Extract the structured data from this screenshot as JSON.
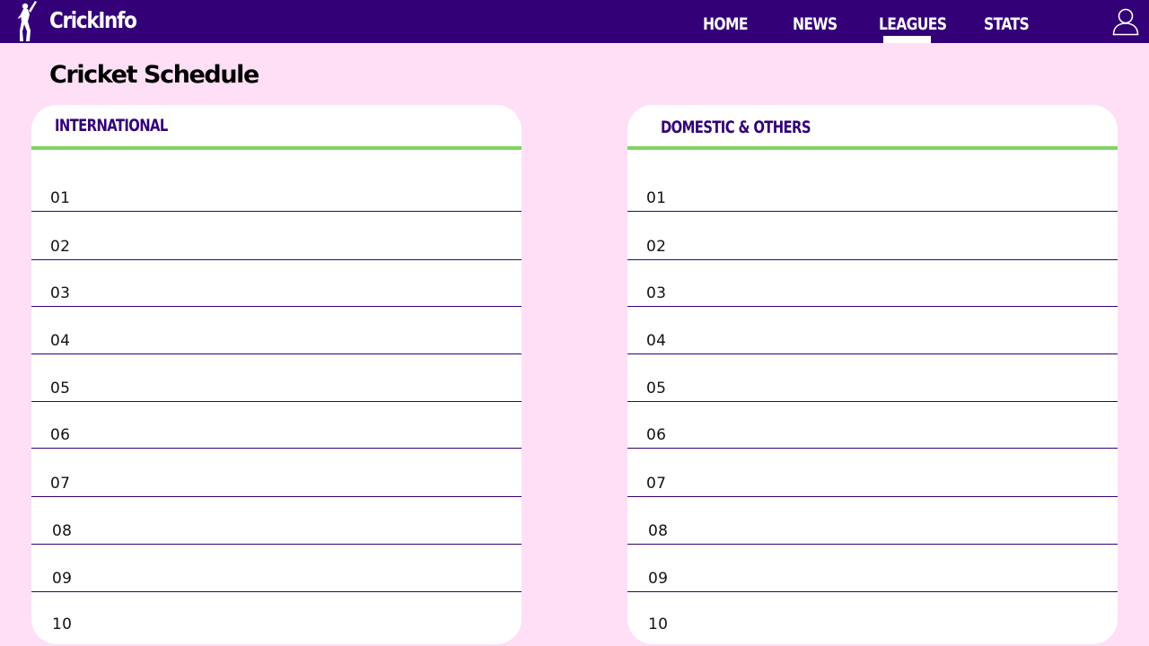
{
  "brand": {
    "name": "CrickInfo",
    "logo_icon": "cricket-batsman-icon"
  },
  "nav": {
    "items": [
      {
        "label": "HOME"
      },
      {
        "label": "NEWS"
      },
      {
        "label": "LEAGUES",
        "active": true
      },
      {
        "label": "STATS"
      }
    ],
    "user_icon": "user-icon"
  },
  "page": {
    "title": "Cricket Schedule"
  },
  "panels": [
    {
      "title": "INTERNATIONAL",
      "rows": [
        "01",
        "02",
        "03",
        "04",
        "05",
        "06",
        "07",
        "08",
        "09",
        "10"
      ]
    },
    {
      "title": "DOMESTIC & OTHERS",
      "rows": [
        "01",
        "02",
        "03",
        "04",
        "05",
        "06",
        "07",
        "08",
        "09",
        "10"
      ]
    }
  ],
  "colors": {
    "navbar": "#330077",
    "background": "#ffdff5",
    "accent_green": "#7ed55f",
    "heading_purple": "#330077"
  }
}
